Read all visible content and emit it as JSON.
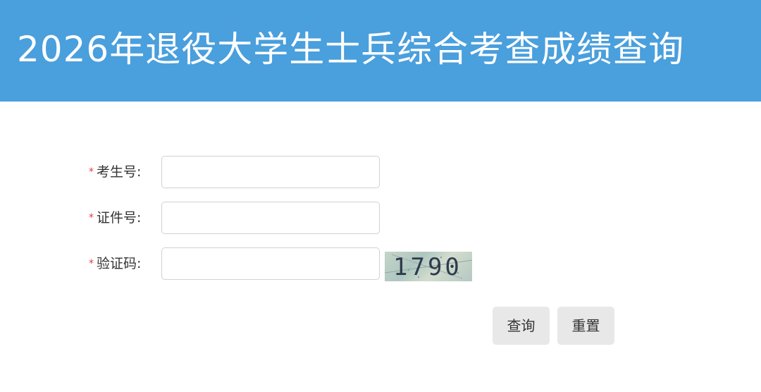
{
  "header": {
    "title": "2026年退役大学生士兵综合考查成绩查询"
  },
  "form": {
    "required_mark": "*",
    "fields": [
      {
        "label": "考生号:",
        "value": "",
        "placeholder": ""
      },
      {
        "label": "证件号:",
        "value": "",
        "placeholder": ""
      },
      {
        "label": "验证码:",
        "value": "",
        "placeholder": ""
      }
    ],
    "captcha": {
      "text": "1790"
    }
  },
  "actions": {
    "query_label": "查询",
    "reset_label": "重置"
  },
  "colors": {
    "header_bg": "#4a9fdd",
    "required": "#e4393c",
    "button_bg": "#e8e8e8"
  }
}
